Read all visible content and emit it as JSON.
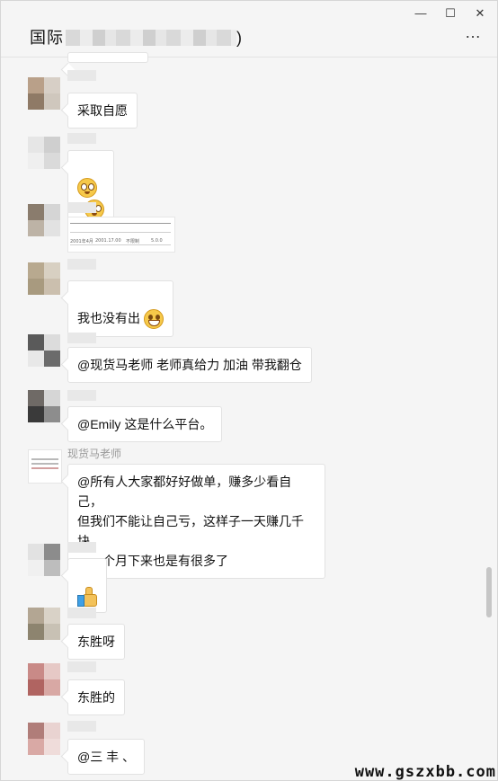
{
  "window": {
    "title_prefix": "国际",
    "title_suffix": ")",
    "minimize": "—",
    "maximize": "☐",
    "close": "✕",
    "more": "…"
  },
  "messages": [
    {
      "id": "m1",
      "text": "采取自愿"
    },
    {
      "id": "m2",
      "emojis": [
        "flushed-face",
        "flushed-face"
      ]
    },
    {
      "id": "m3",
      "image": {
        "cells": [
          "2001年4月",
          "2001.17.00",
          "不限制",
          "5.0.0"
        ]
      }
    },
    {
      "id": "m4",
      "text": "我也没有出",
      "emoji": "grinning-face"
    },
    {
      "id": "m5",
      "text": "@现货马老师 老师真给力 加油 带我翻仓"
    },
    {
      "id": "m6",
      "text": "@Emily 这是什么平台。"
    },
    {
      "id": "m7",
      "sender": "现货马老师",
      "text": "@所有人大家都好好做单，赚多少看自己，\n但我们不能让自己亏，这样子一天赚几千块\n，一个月下来也是有很多了"
    },
    {
      "id": "m8",
      "emoji": "thumbs-up"
    },
    {
      "id": "m9",
      "text": "东胜呀"
    },
    {
      "id": "m10",
      "text": "东胜的"
    },
    {
      "id": "m11",
      "text": "@三 丰 、"
    }
  ],
  "watermark": "www.gszxbb.com",
  "colors": {
    "bubble": "#ffffff",
    "background": "#f5f5f5",
    "border": "#e2e2e2"
  }
}
